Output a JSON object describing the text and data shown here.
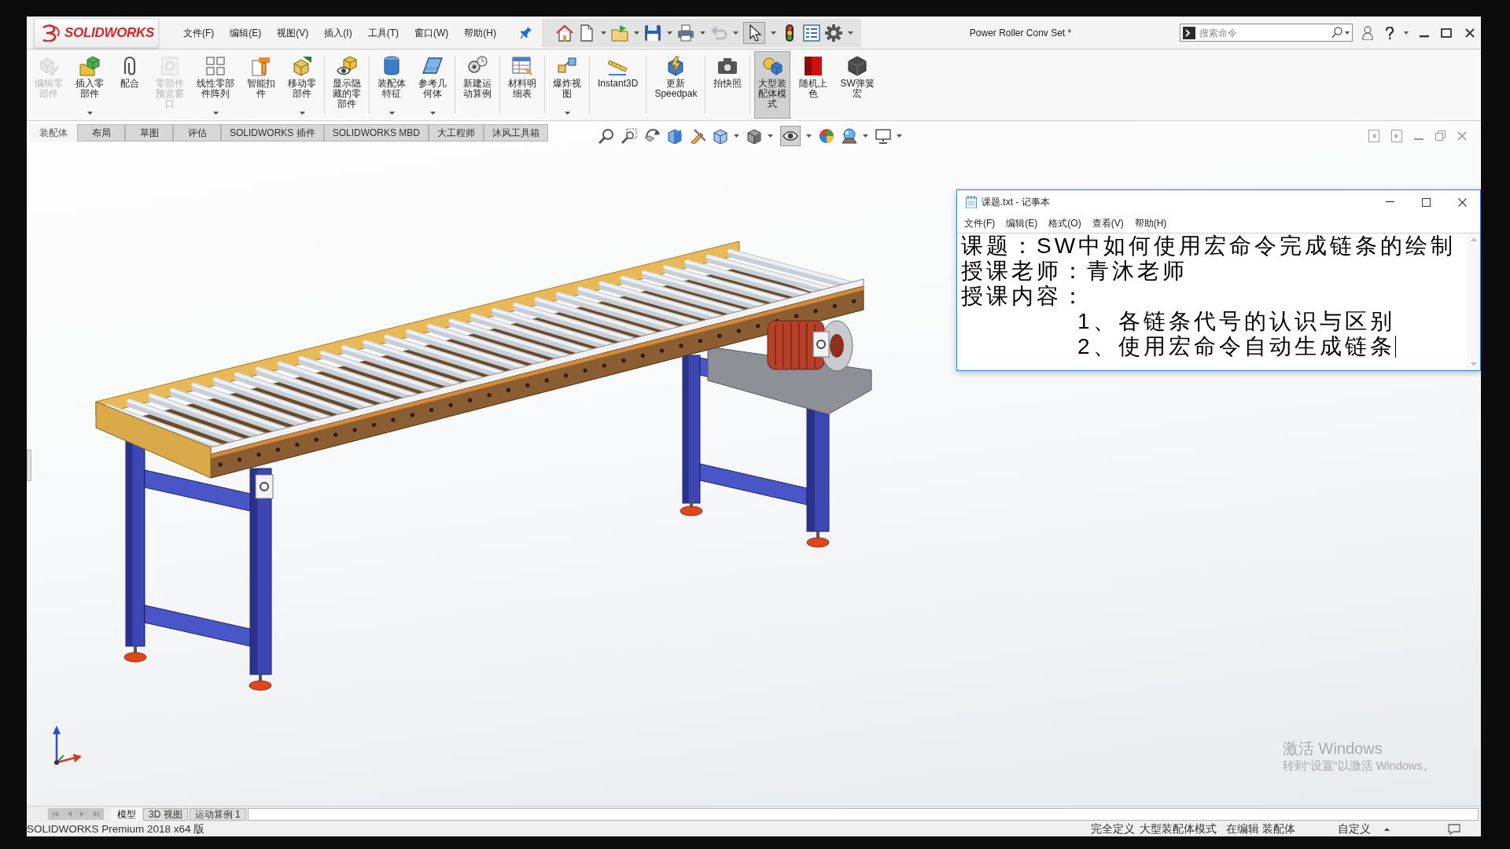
{
  "window": {
    "logo_text": "SOLIDWORKS",
    "title": "Power Roller Conv Set *"
  },
  "menu": [
    "文件(F)",
    "编辑(E)",
    "视图(V)",
    "插入(I)",
    "工具(T)",
    "窗口(W)",
    "帮助(H)"
  ],
  "quick_access": [
    {
      "dropdown": false,
      "disabled": false,
      "selected": false
    },
    {
      "dropdown": true,
      "disabled": false,
      "selected": false
    },
    {
      "dropdown": true,
      "disabled": false,
      "selected": false
    },
    {
      "dropdown": true,
      "disabled": false,
      "selected": false
    },
    {
      "dropdown": true,
      "disabled": false,
      "selected": false
    },
    {
      "dropdown": true,
      "disabled": true,
      "selected": false
    },
    {
      "dropdown": true,
      "disabled": false,
      "selected": true
    },
    {
      "dropdown": false,
      "disabled": false,
      "selected": false
    },
    {
      "dropdown": false,
      "disabled": false,
      "selected": false
    },
    {
      "dropdown": true,
      "disabled": false,
      "selected": false
    }
  ],
  "search": {
    "placeholder": "搜索命令"
  },
  "ribbon": {
    "groups": [
      {
        "buttons": [
          {
            "label_lines": [
              "编辑零",
              "部件"
            ],
            "disabled": true,
            "selected": false,
            "dropdown": false
          },
          {
            "label_lines": [
              "插入零",
              "部件"
            ],
            "disabled": false,
            "selected": false,
            "dropdown": true
          },
          {
            "label_lines": [
              "配合"
            ],
            "disabled": false,
            "selected": false,
            "dropdown": false
          },
          {
            "label_lines": [
              "零部件",
              "预览窗",
              "口"
            ],
            "disabled": true,
            "selected": false,
            "dropdown": false
          },
          {
            "label_lines": [
              "线性零部",
              "件阵列"
            ],
            "disabled": false,
            "selected": false,
            "dropdown": true
          },
          {
            "label_lines": [
              "智能扣",
              "件"
            ],
            "disabled": false,
            "selected": false,
            "dropdown": false
          },
          {
            "label_lines": [
              "移动零",
              "部件"
            ],
            "disabled": false,
            "selected": false,
            "dropdown": true
          }
        ]
      },
      {
        "buttons": [
          {
            "label_lines": [
              "显示隐",
              "藏的零",
              "部件"
            ],
            "disabled": false,
            "selected": false,
            "dropdown": false
          }
        ]
      },
      {
        "buttons": [
          {
            "label_lines": [
              "装配体",
              "特征"
            ],
            "disabled": false,
            "selected": false,
            "dropdown": true
          },
          {
            "label_lines": [
              "参考几",
              "何体"
            ],
            "disabled": false,
            "selected": false,
            "dropdown": true
          }
        ]
      },
      {
        "buttons": [
          {
            "label_lines": [
              "新建运",
              "动算例"
            ],
            "disabled": false,
            "selected": false,
            "dropdown": false
          }
        ]
      },
      {
        "buttons": [
          {
            "label_lines": [
              "材料明",
              "细表"
            ],
            "disabled": false,
            "selected": false,
            "dropdown": false
          }
        ]
      },
      {
        "buttons": [
          {
            "label_lines": [
              "爆炸视",
              "图"
            ],
            "disabled": false,
            "selected": false,
            "dropdown": true
          }
        ]
      },
      {
        "buttons": [
          {
            "label_lines": [
              "Instant3D"
            ],
            "disabled": false,
            "selected": false,
            "dropdown": false
          }
        ]
      },
      {
        "buttons": [
          {
            "label_lines": [
              "更新",
              "Speedpak"
            ],
            "disabled": false,
            "selected": false,
            "dropdown": false
          }
        ]
      },
      {
        "buttons": [
          {
            "label_lines": [
              "拍快照"
            ],
            "disabled": false,
            "selected": false,
            "dropdown": false
          }
        ]
      },
      {
        "buttons": [
          {
            "label_lines": [
              "大型装",
              "配体模",
              "式"
            ],
            "disabled": false,
            "selected": true,
            "dropdown": false
          },
          {
            "label_lines": [
              "随机上",
              "色"
            ],
            "disabled": false,
            "selected": false,
            "dropdown": false
          },
          {
            "label_lines": [
              "SW弹簧",
              "宏"
            ],
            "disabled": false,
            "selected": false,
            "dropdown": false
          }
        ]
      }
    ]
  },
  "command_tabs": [
    {
      "label": "装配体",
      "selected": true
    },
    {
      "label": "布局",
      "selected": false
    },
    {
      "label": "草图",
      "selected": false
    },
    {
      "label": "评估",
      "selected": false
    },
    {
      "label": "SOLIDWORKS 插件",
      "selected": false
    },
    {
      "label": "SOLIDWORKS MBD",
      "selected": false
    },
    {
      "label": "大工程师",
      "selected": false
    },
    {
      "label": "沐风工具箱",
      "selected": false
    }
  ],
  "view_toolbar": [
    {
      "dropdown": false,
      "selected": false
    },
    {
      "dropdown": false,
      "selected": false
    },
    {
      "dropdown": false,
      "selected": false
    },
    {
      "dropdown": false,
      "selected": false
    },
    {
      "dropdown": false,
      "selected": false
    },
    {
      "dropdown": true,
      "selected": false
    },
    {
      "dropdown": true,
      "selected": false
    },
    {
      "dropdown": true,
      "selected": true
    },
    {
      "dropdown": false,
      "selected": false
    },
    {
      "dropdown": true,
      "selected": false
    },
    {
      "dropdown": true,
      "selected": false
    }
  ],
  "notepad": {
    "title": "课题.txt - 记事本",
    "menu": [
      "文件(F)",
      "编辑(E)",
      "格式(O)",
      "查看(V)",
      "帮助(H)"
    ],
    "lines": [
      {
        "text": "课题：SW中如何使用宏命令完成链条的绘制",
        "cursor": false
      },
      {
        "text": "授课老师：青沐老师",
        "cursor": false
      },
      {
        "text": "授课内容：",
        "cursor": false
      },
      {
        "text": "\t\t1、各链条代号的认识与区别",
        "cursor": false
      },
      {
        "text": "\t\t2、使用宏命令自动生成链条",
        "cursor": true
      }
    ]
  },
  "activation_notice": {
    "title": "激活 Windows",
    "message": "转到“设置”以激活 Windows。"
  },
  "document_tabs": [
    {
      "label": "模型",
      "selected": true
    },
    {
      "label": "3D 视图",
      "selected": false
    },
    {
      "label": "运动算例 1",
      "selected": false
    }
  ],
  "status_bar": {
    "version": "SOLIDWORKS Premium 2018 x64 版",
    "items": [
      "完全定义",
      "大型装配体模式",
      "在编辑 装配体",
      "自定义"
    ]
  }
}
